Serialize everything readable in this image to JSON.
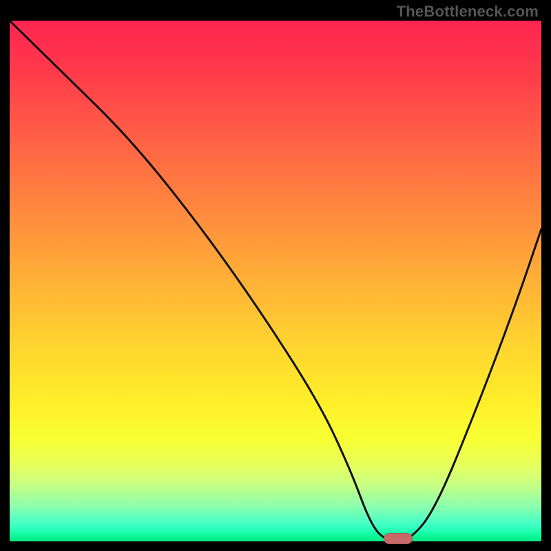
{
  "watermark": "TheBottleneck.com",
  "chart_data": {
    "type": "line",
    "title": "",
    "xlabel": "",
    "ylabel": "",
    "xlim": [
      0,
      100
    ],
    "ylim": [
      0,
      100
    ],
    "background_gradient": {
      "top": "#ff2450",
      "mid": "#ffd62f",
      "bottom": "#05e884"
    },
    "series": [
      {
        "name": "bottleneck-curve",
        "x": [
          0,
          10,
          22,
          34,
          46,
          58,
          64,
          68,
          71,
          75,
          80,
          88,
          95,
          100
        ],
        "y": [
          100,
          90,
          78,
          63,
          46,
          27,
          14,
          3,
          0,
          0,
          6,
          26,
          45,
          60
        ]
      }
    ],
    "marker": {
      "name": "optimal-point",
      "x": 73,
      "y": 0,
      "color": "#c96a6a"
    },
    "grid": false,
    "legend": false
  }
}
